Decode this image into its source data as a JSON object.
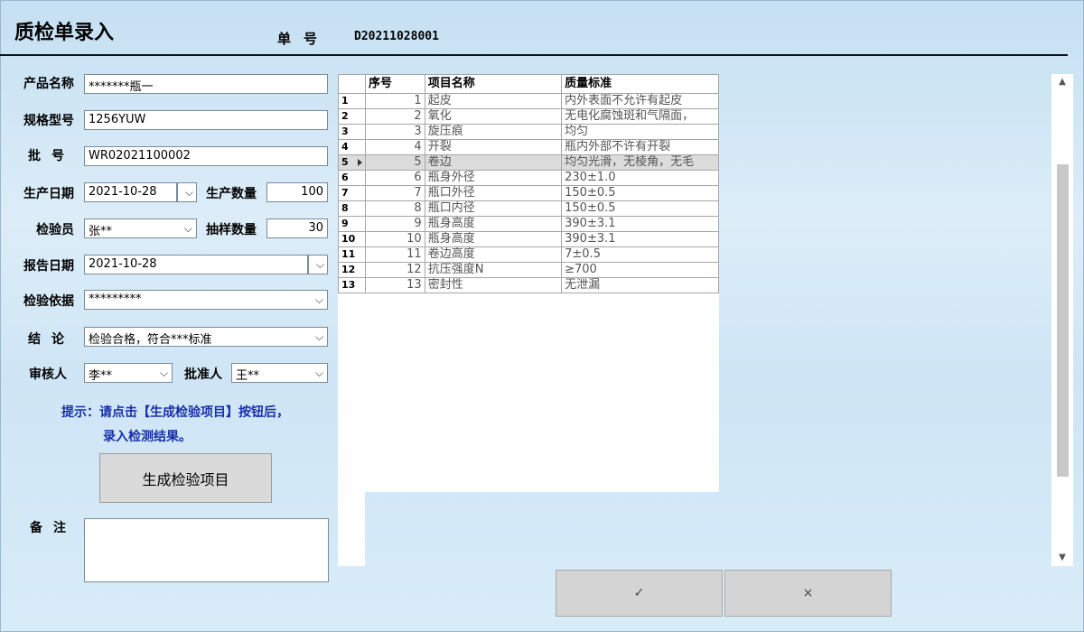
{
  "header": {
    "title": "质检单录入",
    "docno_label": "单号",
    "docno_value": "D20211028001"
  },
  "form": {
    "product_name": {
      "label": "产品名称",
      "value": "*******瓶一"
    },
    "spec": {
      "label": "规格型号",
      "value": "1256YUW"
    },
    "batch": {
      "label": "批号",
      "value": "WR02021100002"
    },
    "prod_date": {
      "label": "生产日期",
      "value": "2021-10-28"
    },
    "prod_qty": {
      "label": "生产数量",
      "value": "100"
    },
    "inspector": {
      "label": "检验员",
      "value": "张**"
    },
    "sample_qty": {
      "label": "抽样数量",
      "value": "30"
    },
    "report_date": {
      "label": "报告日期",
      "value": "2021-10-28"
    },
    "basis": {
      "label": "检验依据",
      "value": "*********"
    },
    "conclusion": {
      "label": "结论",
      "value": "检验合格，符合***标准"
    },
    "reviewer": {
      "label": "审核人",
      "value": "李**"
    },
    "approver": {
      "label": "批准人",
      "value": "王**"
    },
    "hint_line1": "提示：请点击【生成检验项目】按钮后，",
    "hint_line2": "录入检测结果。",
    "generate_button": "生成检验项目",
    "remark_label": "备注"
  },
  "grid": {
    "headers": [
      "序号",
      "项目名称",
      "质量标准"
    ],
    "selected_row": 5,
    "rows": [
      {
        "idx": "1",
        "seq": "1",
        "name": "起皮",
        "std": "内外表面不允许有起皮"
      },
      {
        "idx": "2",
        "seq": "2",
        "name": "氧化",
        "std": "无电化腐蚀斑和气隔面，"
      },
      {
        "idx": "3",
        "seq": "3",
        "name": "旋压痕",
        "std": "均匀"
      },
      {
        "idx": "4",
        "seq": "4",
        "name": "开裂",
        "std": "瓶内外部不许有开裂"
      },
      {
        "idx": "5",
        "seq": "5",
        "name": "卷边",
        "std": "均匀光滑，无棱角，无毛"
      },
      {
        "idx": "6",
        "seq": "6",
        "name": "瓶身外径",
        "std": "230±1.0"
      },
      {
        "idx": "7",
        "seq": "7",
        "name": "瓶口外径",
        "std": "150±0.5"
      },
      {
        "idx": "8",
        "seq": "8",
        "name": "瓶口内径",
        "std": "150±0.5"
      },
      {
        "idx": "9",
        "seq": "9",
        "name": "瓶身高度",
        "std": "390±3.1"
      },
      {
        "idx": "10",
        "seq": "10",
        "name": "瓶身高度",
        "std": "390±3.1"
      },
      {
        "idx": "11",
        "seq": "11",
        "name": "卷边高度",
        "std": "7±0.5"
      },
      {
        "idx": "12",
        "seq": "12",
        "name": "抗压强度N",
        "std": "≥700"
      },
      {
        "idx": "13",
        "seq": "13",
        "name": "密封性",
        "std": "无泄漏"
      }
    ]
  },
  "actions": {
    "ok_icon": "✓",
    "cancel_icon": "×"
  },
  "icons": {
    "dropdown": "chevron-down-icon",
    "scroll_up": "scroll-up-icon",
    "scroll_down": "scroll-down-icon"
  }
}
